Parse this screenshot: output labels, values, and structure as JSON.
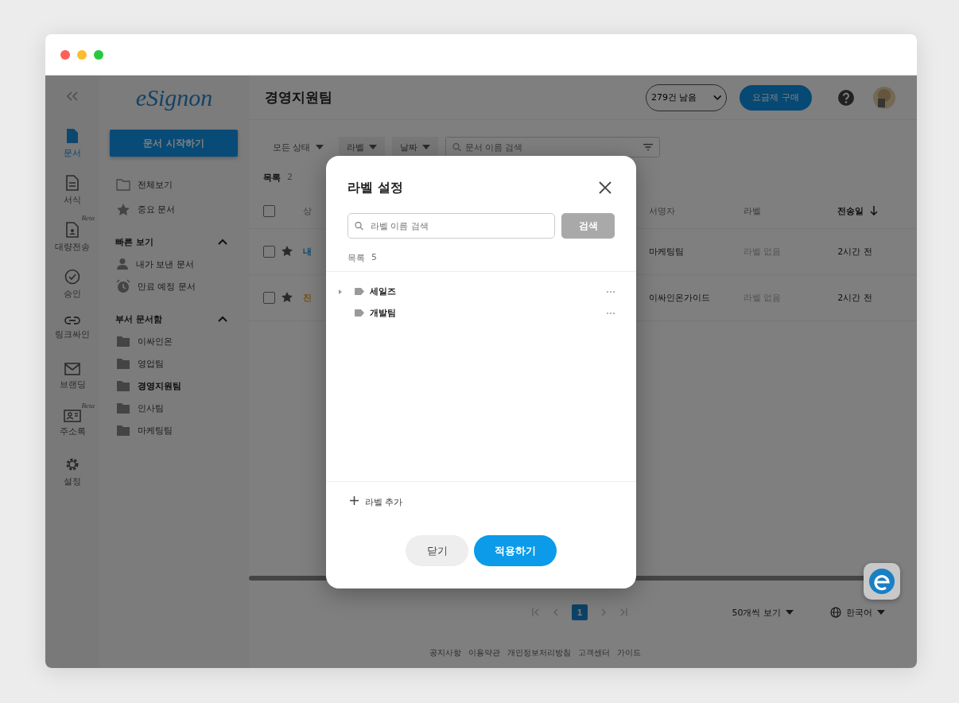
{
  "rail": {
    "items": [
      {
        "label": "문서",
        "kind": "doc",
        "selected": true
      },
      {
        "label": "서식",
        "kind": "form",
        "selected": false
      },
      {
        "label": "대량전송",
        "kind": "bulk",
        "selected": false,
        "badge": "Beta"
      },
      {
        "label": "승인",
        "kind": "check",
        "selected": false
      },
      {
        "label": "링크싸인",
        "kind": "link",
        "selected": false
      },
      {
        "label": "브랜딩",
        "kind": "mail",
        "selected": false
      },
      {
        "label": "주소록",
        "kind": "contacts",
        "selected": false,
        "badge": "Beta"
      },
      {
        "label": "설정",
        "kind": "gear",
        "selected": false
      }
    ]
  },
  "logo": "eSignon",
  "start_button": "문서 시작하기",
  "sidebar": {
    "items": [
      {
        "label": "전체보기",
        "kind": "folder-outline"
      },
      {
        "label": "중요 문서",
        "kind": "star"
      }
    ],
    "sections": [
      {
        "title": "빠른 보기",
        "expanded": true,
        "items": [
          {
            "label": "내가 보낸 문서",
            "kind": "person",
            "selected": false
          },
          {
            "label": "만료 예정 문서",
            "kind": "alarm",
            "selected": false
          }
        ]
      },
      {
        "title": "부서 문서함",
        "expanded": true,
        "items": [
          {
            "label": "이싸인온",
            "kind": "folder",
            "selected": false
          },
          {
            "label": "영업팀",
            "kind": "folder",
            "selected": false
          },
          {
            "label": "경영지원팀",
            "kind": "folder",
            "selected": true
          },
          {
            "label": "인사팀",
            "kind": "folder",
            "selected": false
          },
          {
            "label": "마케팅팀",
            "kind": "folder",
            "selected": false
          }
        ]
      }
    ]
  },
  "header": {
    "title": "경영지원팀",
    "quota": "279건 남음",
    "buy_button": "요금제 구매"
  },
  "filters": [
    {
      "label": "모든 상태"
    },
    {
      "label": "라벨"
    },
    {
      "label": "날짜"
    }
  ],
  "search": {
    "placeholder": "문서 이름 검색"
  },
  "list": {
    "label": "목록",
    "count": "2",
    "all_checked": false,
    "columns": [
      {
        "label": "상",
        "sorted": false
      },
      {
        "label": "서명자",
        "sorted": false
      },
      {
        "label": "라벨",
        "sorted": false
      },
      {
        "label": "전송일",
        "sorted": true
      }
    ],
    "rows": [
      {
        "title": "내",
        "color": "#0d4870",
        "checked": false,
        "signer": "마케팅팀",
        "label": "라벨 없음",
        "sent": "2시간 전"
      },
      {
        "title": "진",
        "color": "#785010",
        "checked": false,
        "signer": "이싸인온가이드",
        "label": "라벨 없음",
        "sent": "2시간 전"
      }
    ]
  },
  "pagination": {
    "pages": [
      {
        "label": "1",
        "selected": true
      }
    ]
  },
  "page_size": "50개씩 보기",
  "language": "한국어",
  "footer_links": [
    "공지사항",
    "이용약관",
    "개인정보처리방침",
    "고객센터",
    "가이드"
  ],
  "modal": {
    "title": "라벨 설정",
    "search": {
      "placeholder": "라벨 이름 검색",
      "button": "검색"
    },
    "list_label": "목록",
    "count": "5",
    "labels": [
      {
        "name": "세일즈",
        "expandable": true
      },
      {
        "name": "개발팀",
        "expandable": false
      }
    ],
    "add_label": "라벨 추가",
    "buttons": [
      {
        "label": "닫기",
        "kind": "secondary"
      },
      {
        "label": "적용하기",
        "kind": "primary"
      }
    ]
  }
}
